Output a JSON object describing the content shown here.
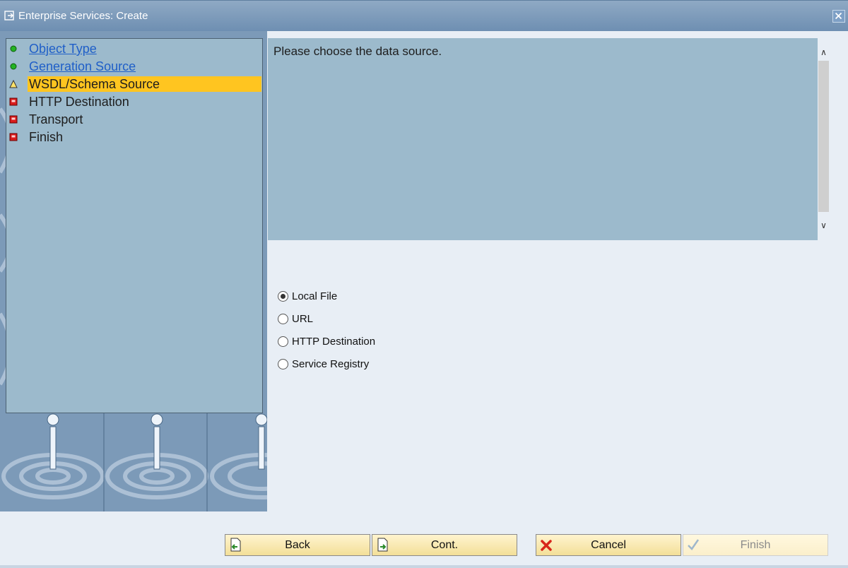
{
  "window": {
    "title": "Enterprise Services: Create"
  },
  "steps": [
    {
      "label": "Object Type",
      "status": "complete"
    },
    {
      "label": "Generation Source",
      "status": "complete"
    },
    {
      "label": "WSDL/Schema Source",
      "status": "current"
    },
    {
      "label": "HTTP Destination",
      "status": "pending"
    },
    {
      "label": "Transport",
      "status": "pending"
    },
    {
      "label": "Finish",
      "status": "pending"
    }
  ],
  "message": {
    "text": "Please choose the data source."
  },
  "data_source": {
    "selected": "Local File",
    "options": [
      "Local File",
      "URL",
      "HTTP Destination",
      "Service Registry"
    ]
  },
  "buttons": {
    "back": "Back",
    "cont": "Cont.",
    "cancel": "Cancel",
    "finish": "Finish"
  },
  "colors": {
    "title_bar": "#7a98b9",
    "steps_panel": "#9cbacc",
    "current_step": "#ffc520",
    "button": "#f7e6a8"
  }
}
